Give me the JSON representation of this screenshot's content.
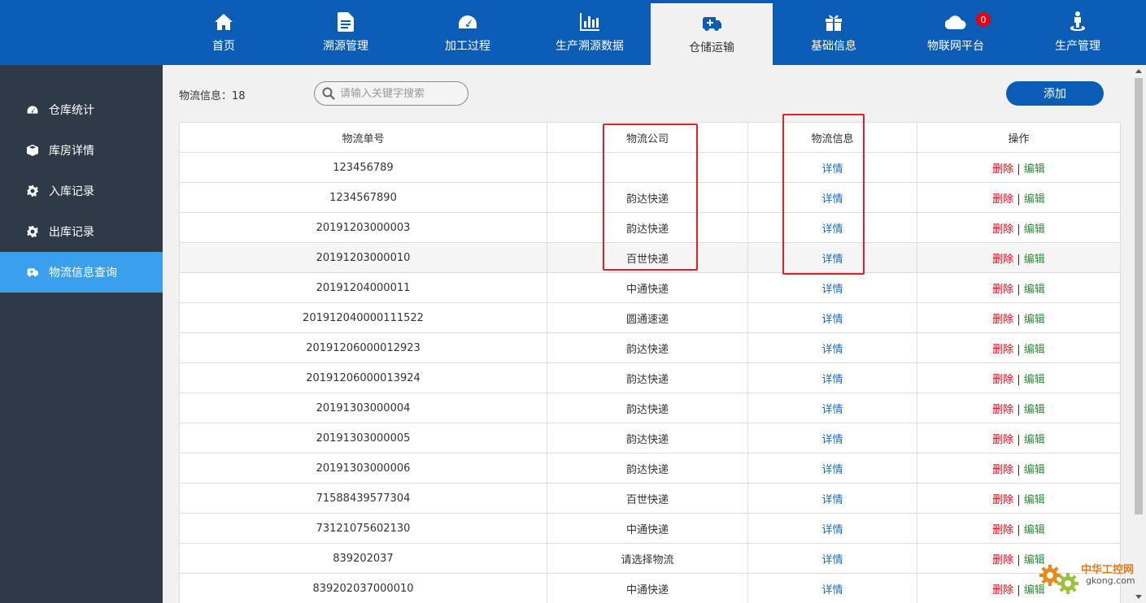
{
  "nav": {
    "items": [
      {
        "label": "首页",
        "icon": "home-icon"
      },
      {
        "label": "溯源管理",
        "icon": "document-icon"
      },
      {
        "label": "加工过程",
        "icon": "dashboard-icon"
      },
      {
        "label": "生产溯源数据",
        "icon": "bar-chart-icon"
      },
      {
        "label": "仓储运输",
        "icon": "ambulance-icon"
      },
      {
        "label": "基础信息",
        "icon": "gift-icon"
      },
      {
        "label": "物联网平台",
        "icon": "cloud-icon"
      },
      {
        "label": "生产管理",
        "icon": "person-pin-icon"
      }
    ],
    "active_index": 4,
    "badge_count": "0"
  },
  "sidebar": {
    "items": [
      {
        "label": "仓库统计",
        "icon": "dashboard-icon"
      },
      {
        "label": "库房详情",
        "icon": "box-icon"
      },
      {
        "label": "入库记录",
        "icon": "gear-icon"
      },
      {
        "label": "出库记录",
        "icon": "gear-icon"
      },
      {
        "label": "物流信息查询",
        "icon": "ambulance-icon"
      }
    ],
    "active_index": 4
  },
  "toolbar": {
    "count_label": "物流信息：18",
    "search_placeholder": "请输入关键字搜索",
    "add_label": "添加"
  },
  "table": {
    "headers": [
      "物流单号",
      "物流公司",
      "物流信息",
      "操作"
    ],
    "detail_label": "详情",
    "delete_label": "删除",
    "separator": "|",
    "edit_label": "编辑",
    "rows": [
      {
        "no": "123456789",
        "company": ""
      },
      {
        "no": "1234567890",
        "company": "韵达快递"
      },
      {
        "no": "20191203000003",
        "company": "韵达快递"
      },
      {
        "no": "20191203000010",
        "company": "百世快递"
      },
      {
        "no": "20191204000011",
        "company": "中通快递"
      },
      {
        "no": "201912040000111522",
        "company": "圆通速递"
      },
      {
        "no": "20191206000012923",
        "company": "韵达快递"
      },
      {
        "no": "20191206000013924",
        "company": "韵达快递"
      },
      {
        "no": "20191303000004",
        "company": "韵达快递"
      },
      {
        "no": "20191303000005",
        "company": "韵达快递"
      },
      {
        "no": "20191303000006",
        "company": "韵达快递"
      },
      {
        "no": "71588439577304",
        "company": "百世快递"
      },
      {
        "no": "73121075602130",
        "company": "中通快递"
      },
      {
        "no": "839202037",
        "company": "请选择物流"
      },
      {
        "no": "839202037000010",
        "company": "中通快递"
      }
    ],
    "highlighted_row": 3
  },
  "watermark": {
    "line1": "中华工控网",
    "line2": "gkong.com"
  },
  "colors": {
    "nav_bg": "#0b5cb5",
    "sidebar_bg": "#2f3a48",
    "sidebar_active": "#3aa0ee",
    "delete": "#e60012",
    "edit": "#2e8b3a",
    "detail": "#1a6cb8",
    "annotation_box": "#e0202a"
  }
}
